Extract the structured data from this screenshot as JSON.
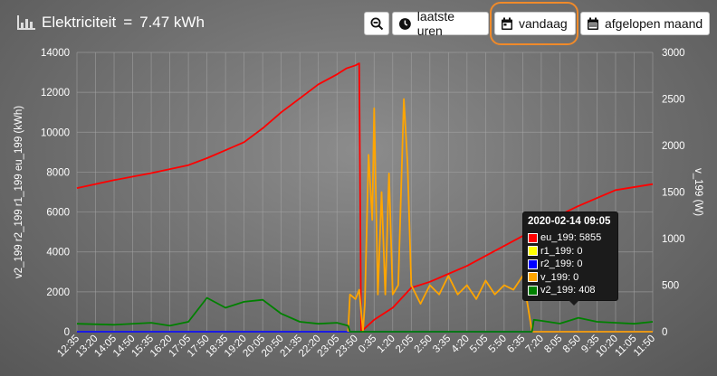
{
  "header": {
    "title": "Elektriciteit",
    "equals": "=",
    "total": "7.47 kWh",
    "buttons": {
      "zoom_icon": "zoom-out-icon",
      "uren": "laatste uren",
      "vandaag": "vandaag",
      "maand": "afgelopen maand"
    },
    "accent": "#f08a2a"
  },
  "chart_data": {
    "type": "line",
    "title": "",
    "xlabel": "",
    "ylabel_left": "v2_199 r2_199 r1_199 eu_199 (kWh)",
    "ylabel_right": "v_199 (W)",
    "left_axis": {
      "min": 0,
      "max": 14000,
      "ticks": [
        "0",
        "2000",
        "4000",
        "6000",
        "8000",
        "10000",
        "12000",
        "14000"
      ]
    },
    "right_axis": {
      "min": 0,
      "max": 3000,
      "ticks": [
        "0",
        "500",
        "1000",
        "1500",
        "2000",
        "2500",
        "3000"
      ]
    },
    "x_ticks": [
      "12:35",
      "13:20",
      "14:05",
      "14:50",
      "15:35",
      "16:20",
      "17:05",
      "17:50",
      "18:35",
      "19:20",
      "20:05",
      "20:50",
      "21:35",
      "22:20",
      "23:05",
      "23:50",
      "0:35",
      "1:20",
      "2:05",
      "2:50",
      "3:35",
      "4:20",
      "5:05",
      "5:50",
      "6:35",
      "7:20",
      "8:05",
      "8:50",
      "9:35",
      "10:20",
      "11:05",
      "11:50"
    ],
    "grid": true,
    "series": [
      {
        "name": "eu_199",
        "axis": "left",
        "color": "#ff0000",
        "points": [
          [
            0,
            7200
          ],
          [
            2,
            7600
          ],
          [
            4,
            7950
          ],
          [
            6,
            8350
          ],
          [
            7,
            8700
          ],
          [
            8,
            9100
          ],
          [
            9,
            9500
          ],
          [
            10,
            10200
          ],
          [
            11,
            11000
          ],
          [
            12,
            11700
          ],
          [
            13,
            12400
          ],
          [
            14,
            12900
          ],
          [
            14.5,
            13200
          ],
          [
            15,
            13350
          ],
          [
            15.2,
            13450
          ],
          [
            15.3,
            0
          ],
          [
            16,
            600
          ],
          [
            17,
            1200
          ],
          [
            18,
            2200
          ],
          [
            19,
            2500
          ],
          [
            20,
            2900
          ],
          [
            21,
            3300
          ],
          [
            22,
            3800
          ],
          [
            23,
            4300
          ],
          [
            24,
            4800
          ],
          [
            25,
            5300
          ],
          [
            26,
            5855
          ],
          [
            27,
            6300
          ],
          [
            28,
            6700
          ],
          [
            29,
            7100
          ],
          [
            31,
            7400
          ]
        ]
      },
      {
        "name": "r1_199",
        "axis": "left",
        "color": "#ffff00",
        "points": [
          [
            0,
            0
          ],
          [
            31,
            0
          ]
        ]
      },
      {
        "name": "r2_199",
        "axis": "left",
        "color": "#0000ff",
        "points": [
          [
            0,
            0
          ],
          [
            31,
            0
          ]
        ]
      },
      {
        "name": "v_199",
        "axis": "right",
        "color": "#ffa500",
        "points": [
          [
            14.6,
            0
          ],
          [
            14.7,
            400
          ],
          [
            15,
            350
          ],
          [
            15.2,
            450
          ],
          [
            15.4,
            0
          ],
          [
            15.5,
            300
          ],
          [
            15.7,
            1900
          ],
          [
            15.9,
            1200
          ],
          [
            16,
            2400
          ],
          [
            16.2,
            400
          ],
          [
            16.4,
            1500
          ],
          [
            16.6,
            400
          ],
          [
            16.8,
            1700
          ],
          [
            17,
            400
          ],
          [
            17.3,
            500
          ],
          [
            17.6,
            2500
          ],
          [
            17.8,
            1800
          ],
          [
            18,
            500
          ],
          [
            18.5,
            300
          ],
          [
            19,
            500
          ],
          [
            19.5,
            400
          ],
          [
            20,
            600
          ],
          [
            20.5,
            400
          ],
          [
            21,
            500
          ],
          [
            21.5,
            350
          ],
          [
            22,
            550
          ],
          [
            22.5,
            400
          ],
          [
            23,
            500
          ],
          [
            23.5,
            450
          ],
          [
            24,
            600
          ],
          [
            24.3,
            250
          ],
          [
            24.5,
            0
          ],
          [
            31,
            0
          ]
        ]
      },
      {
        "name": "v2_199",
        "axis": "left",
        "color": "#008000",
        "points": [
          [
            0,
            400
          ],
          [
            2,
            350
          ],
          [
            4,
            450
          ],
          [
            5,
            300
          ],
          [
            6,
            500
          ],
          [
            7,
            1700
          ],
          [
            8,
            1200
          ],
          [
            9,
            1500
          ],
          [
            10,
            1600
          ],
          [
            11,
            900
          ],
          [
            12,
            500
          ],
          [
            13,
            400
          ],
          [
            14,
            450
          ],
          [
            14.6,
            300
          ],
          [
            14.7,
            0
          ],
          [
            24.5,
            0
          ],
          [
            24.6,
            600
          ],
          [
            25,
            550
          ],
          [
            26,
            408
          ],
          [
            27,
            700
          ],
          [
            28,
            500
          ],
          [
            29,
            450
          ],
          [
            30,
            400
          ],
          [
            31,
            500
          ]
        ]
      }
    ]
  },
  "tooltip": {
    "title": "2020-02-14 09:05",
    "rows": [
      {
        "label": "eu_199: 5855",
        "color": "#ff0000"
      },
      {
        "label": "r1_199: 0",
        "color": "#ffff00"
      },
      {
        "label": "r2_199: 0",
        "color": "#0000ff"
      },
      {
        "label": "v_199: 0",
        "color": "#ffa500"
      },
      {
        "label": "v2_199: 408",
        "color": "#008000"
      }
    ]
  }
}
